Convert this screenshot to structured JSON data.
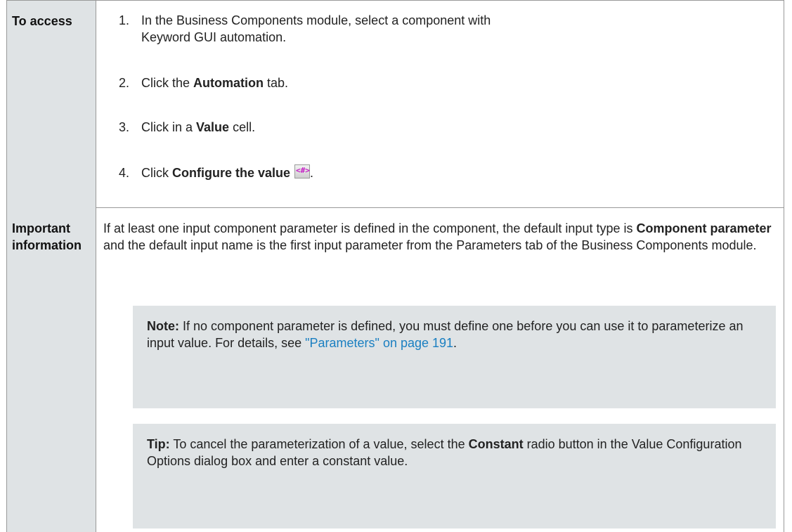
{
  "access": {
    "header": "To access",
    "steps": [
      {
        "num": "1.",
        "text": "In the Business Components module, select a component with Keyword GUI automation."
      },
      {
        "num": "2.",
        "pre": "Click the ",
        "bold": "Automation",
        "post": " tab."
      },
      {
        "num": "3.",
        "pre": "Click in a ",
        "bold": "Value",
        "post": " cell."
      },
      {
        "num": "4.",
        "pre": "Click ",
        "bold": "Configure the value",
        "post": "."
      }
    ],
    "configure_icon_glyph": "<#>"
  },
  "important": {
    "header_line1": "Important",
    "header_line2": "information",
    "para_pre": "If at least one input component parameter is defined in the component, the default input type is ",
    "para_bold1": "Component parameter",
    "para_post": " and the default input name is the first input parameter from the Parameters tab of the Business Components module.",
    "note": {
      "label": "Note:",
      "text": " If no component parameter is defined, you must define one before you can use it to parameterize an input value. For details, see ",
      "link": "\"Parameters\" on page 191",
      "end": "."
    },
    "tip": {
      "label": "Tip:",
      "pre": " To cancel the parameterization of a value, select the ",
      "bold": "Constant",
      "post": " radio button in the Value Configuration Options dialog box and enter a constant value."
    }
  },
  "colors": {
    "header_bg": "#dfe3e5",
    "note_bg": "#dfe3e5",
    "link": "#1a7fc1",
    "border": "#999999"
  }
}
